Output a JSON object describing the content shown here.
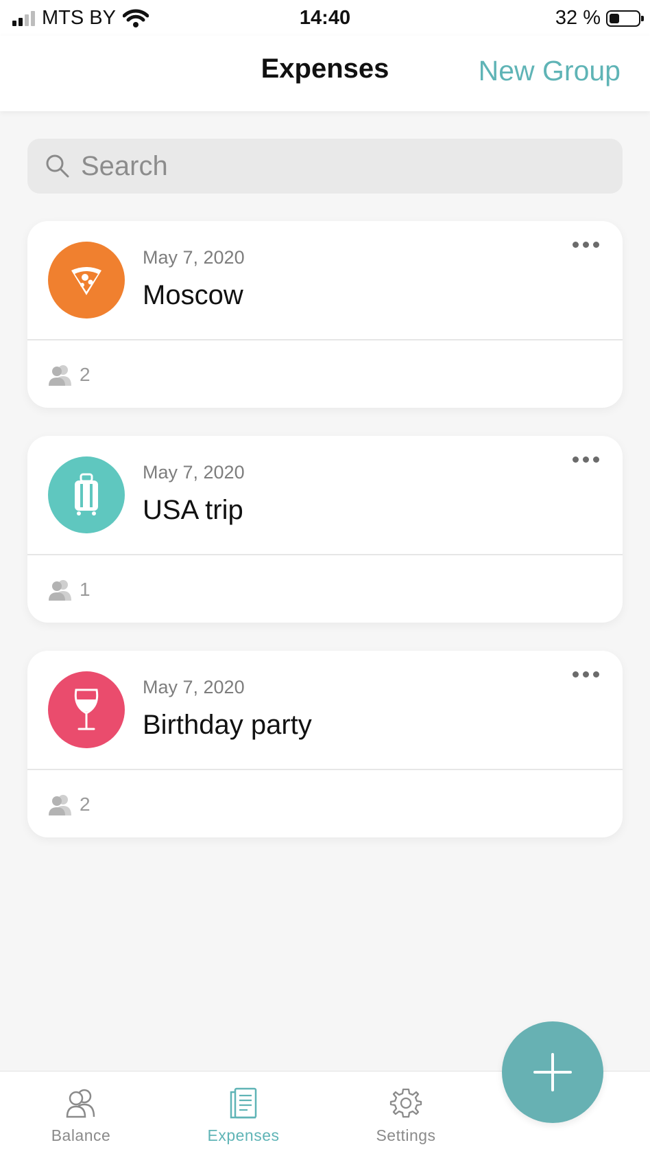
{
  "status_bar": {
    "carrier": "MTS BY",
    "time": "14:40",
    "battery": "32 %"
  },
  "nav": {
    "title": "Expenses",
    "new_group_label": "New Group"
  },
  "search": {
    "placeholder": "Search"
  },
  "groups": [
    {
      "date": "May 7, 2020",
      "name": "Moscow",
      "members": "2",
      "icon": "pizza-icon",
      "color": "#f0802f"
    },
    {
      "date": "May 7, 2020",
      "name": "USA trip",
      "members": "1",
      "icon": "suitcase-icon",
      "color": "#5fc7bf"
    },
    {
      "date": "May 7, 2020",
      "name": "Birthday party",
      "members": "2",
      "icon": "wine-glass-icon",
      "color": "#ea4c6d"
    }
  ],
  "tabs": [
    {
      "label": "Balance",
      "icon": "users-icon",
      "active": false
    },
    {
      "label": "Expenses",
      "icon": "receipt-icon",
      "active": true
    },
    {
      "label": "Settings",
      "icon": "gear-icon",
      "active": false
    }
  ],
  "colors": {
    "accent": "#5fb4b6",
    "fab": "#67b1b3"
  }
}
